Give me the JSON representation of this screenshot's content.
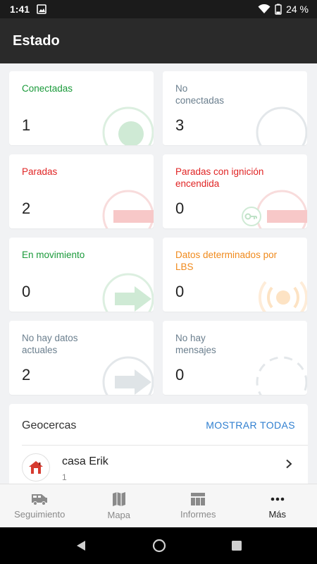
{
  "status_bar": {
    "time": "1:41",
    "battery": "24 %"
  },
  "app_bar": {
    "title": "Estado"
  },
  "cards": [
    {
      "label": "Conectadas",
      "value": "1",
      "color": "#1a9a3a"
    },
    {
      "label": "No conectadas",
      "value": "3",
      "color": "#6b7f8e"
    },
    {
      "label": "Paradas",
      "value": "2",
      "color": "#e02424"
    },
    {
      "label": "Paradas con ignición encendida",
      "value": "0",
      "color": "#e02424"
    },
    {
      "label": "En movimiento",
      "value": "0",
      "color": "#1a9a3a"
    },
    {
      "label": "Datos determinados por LBS",
      "value": "0",
      "color": "#f08a1c"
    },
    {
      "label": "No hay datos actuales",
      "value": "2",
      "color": "#6b7f8e"
    },
    {
      "label": "No hay mensajes",
      "value": "0",
      "color": "#6b7f8e"
    }
  ],
  "geofences": {
    "title": "Geocercas",
    "show_all": "MOSTRAR TODAS",
    "items": [
      {
        "name": "casa Erik",
        "count": "1"
      }
    ]
  },
  "bottom_nav": [
    {
      "label": "Seguimiento",
      "icon": "van-icon"
    },
    {
      "label": "Mapa",
      "icon": "map-icon"
    },
    {
      "label": "Informes",
      "icon": "table-icon"
    },
    {
      "label": "Más",
      "icon": "more-icon"
    }
  ]
}
